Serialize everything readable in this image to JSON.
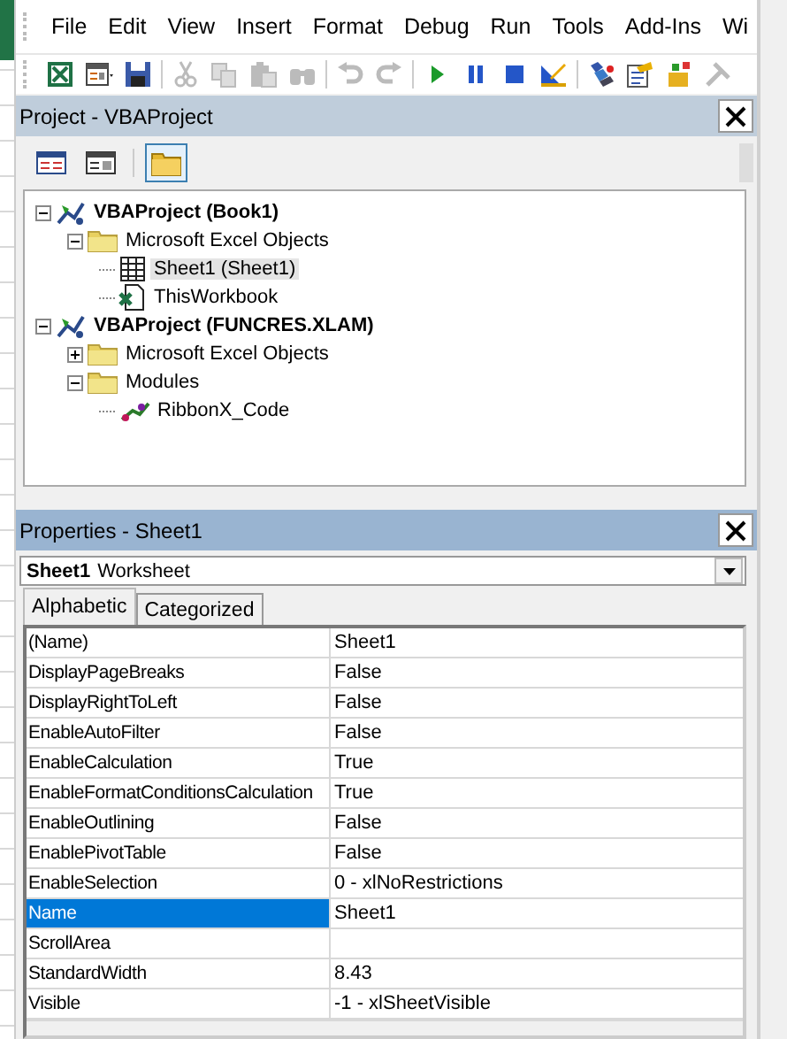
{
  "menu": [
    "File",
    "Edit",
    "View",
    "Insert",
    "Format",
    "Debug",
    "Run",
    "Tools",
    "Add-Ins",
    "Wi"
  ],
  "toolbar": [
    {
      "disabled": false
    },
    {
      "disabled": false
    },
    {
      "disabled": false
    },
    {
      "disabled": true
    },
    {
      "disabled": true
    },
    {
      "disabled": true
    },
    {
      "disabled": true
    },
    {
      "disabled": true
    },
    {
      "disabled": true
    },
    {
      "disabled": false
    },
    {
      "disabled": false
    },
    {
      "disabled": false
    },
    {
      "disabled": false
    },
    {
      "disabled": false
    },
    {
      "disabled": false
    },
    {
      "disabled": false
    },
    {
      "disabled": true
    }
  ],
  "project": {
    "title": "Project - VBAProject",
    "toolbar": [
      {
        "selected": false
      },
      {
        "selected": false
      },
      {
        "selected": true
      }
    ],
    "tree": [
      {
        "label": "VBAProject (Book1)",
        "kind": "project",
        "expanded": true,
        "children": [
          {
            "label": "Microsoft Excel Objects",
            "kind": "folder",
            "expanded": true,
            "children": [
              {
                "label": "Sheet1 (Sheet1)",
                "kind": "sheet",
                "selected": true
              },
              {
                "label": "ThisWorkbook",
                "kind": "workbook",
                "selected": false
              }
            ]
          }
        ]
      },
      {
        "label": "VBAProject (FUNCRES.XLAM)",
        "kind": "project",
        "expanded": true,
        "children": [
          {
            "label": "Microsoft Excel Objects",
            "kind": "folder",
            "expanded": false
          },
          {
            "label": "Modules",
            "kind": "folder",
            "expanded": true,
            "children": [
              {
                "label": "RibbonX_Code",
                "kind": "module",
                "selected": false
              }
            ]
          }
        ]
      }
    ]
  },
  "properties": {
    "title": "Properties - Sheet1",
    "object": {
      "name": "Sheet1",
      "type": "Worksheet"
    },
    "tabs": [
      {
        "label": "Alphabetic",
        "selected": true
      },
      {
        "label": "Categorized",
        "selected": false
      }
    ],
    "rows": [
      {
        "name": "(Name)",
        "value": "Sheet1",
        "selected": false
      },
      {
        "name": "DisplayPageBreaks",
        "value": "False",
        "selected": false
      },
      {
        "name": "DisplayRightToLeft",
        "value": "False",
        "selected": false
      },
      {
        "name": "EnableAutoFilter",
        "value": "False",
        "selected": false
      },
      {
        "name": "EnableCalculation",
        "value": "True",
        "selected": false
      },
      {
        "name": "EnableFormatConditionsCalculation",
        "value": "True",
        "selected": false
      },
      {
        "name": "EnableOutlining",
        "value": "False",
        "selected": false
      },
      {
        "name": "EnablePivotTable",
        "value": "False",
        "selected": false
      },
      {
        "name": "EnableSelection",
        "value": "0 - xlNoRestrictions",
        "selected": false
      },
      {
        "name": "Name",
        "value": "Sheet1",
        "selected": true
      },
      {
        "name": "ScrollArea",
        "selected": false
      },
      {
        "name": "StandardWidth",
        "value": "8.43",
        "selected": false
      },
      {
        "name": "Visible",
        "value": "-1 - xlSheetVisible",
        "selected": false
      }
    ]
  }
}
